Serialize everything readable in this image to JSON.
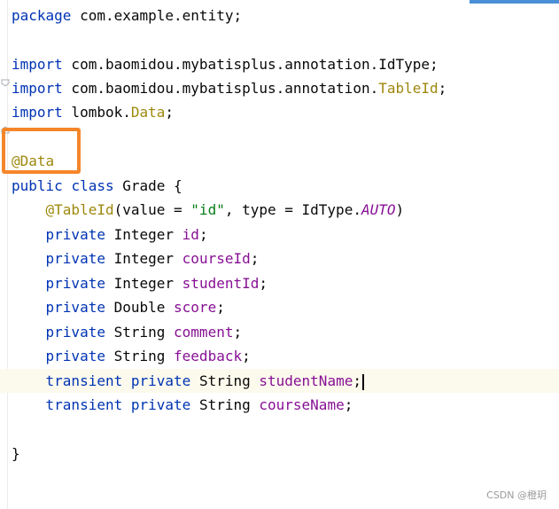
{
  "editor": {
    "lines": {
      "l1": {
        "kw": "package",
        "rest": " com.example.entity;"
      },
      "l3": {
        "kw": "import",
        "pkg": " com.baomidou.mybatisplus.annotation.IdType;"
      },
      "l4": {
        "kw": "import",
        "pkg": " com.baomidou.mybatisplus.annotation.",
        "cls": "TableId",
        "end": ";"
      },
      "l5": {
        "kw": "import",
        "pkg": " lombok.",
        "cls": "Data",
        "end": ";"
      },
      "l7": {
        "ann": "@Data"
      },
      "l8": {
        "kw1": "public",
        "kw2": "class",
        "rest": " Grade {"
      },
      "l9": {
        "ann": "@TableId",
        "p1": "(value = ",
        "str": "\"id\"",
        "p2": ", type = IdType.",
        "const": "AUTO",
        "p3": ")"
      },
      "l10": {
        "kw": "private",
        "type": " Integer ",
        "field": "id",
        "end": ";"
      },
      "l11": {
        "kw": "private",
        "type": " Integer ",
        "field": "courseId",
        "end": ";"
      },
      "l12": {
        "kw": "private",
        "type": " Integer ",
        "field": "studentId",
        "end": ";"
      },
      "l13": {
        "kw": "private",
        "type": " Double ",
        "field": "score",
        "end": ";"
      },
      "l14": {
        "kw": "private",
        "type": " String ",
        "field": "comment",
        "end": ";"
      },
      "l15": {
        "kw": "private",
        "type": " String ",
        "field": "feedback",
        "end": ";"
      },
      "l16": {
        "kw1": "transient",
        "kw2": "private",
        "type": " String ",
        "field": "studentName",
        "end": ";"
      },
      "l17": {
        "kw1": "transient",
        "kw2": "private",
        "type": " String ",
        "field": "courseName",
        "end": ";"
      },
      "l19": {
        "rest": "}"
      }
    },
    "icons": {
      "fold_open": "fold-open-icon",
      "fold_close": "fold-close-icon"
    },
    "colors": {
      "keyword": "#0033b3",
      "annotation": "#9e880d",
      "field": "#871094",
      "string": "#067d17",
      "highlight_box": "#f5862a",
      "current_line": "#fcfaed"
    }
  },
  "watermark": "CSDN @橙玥"
}
